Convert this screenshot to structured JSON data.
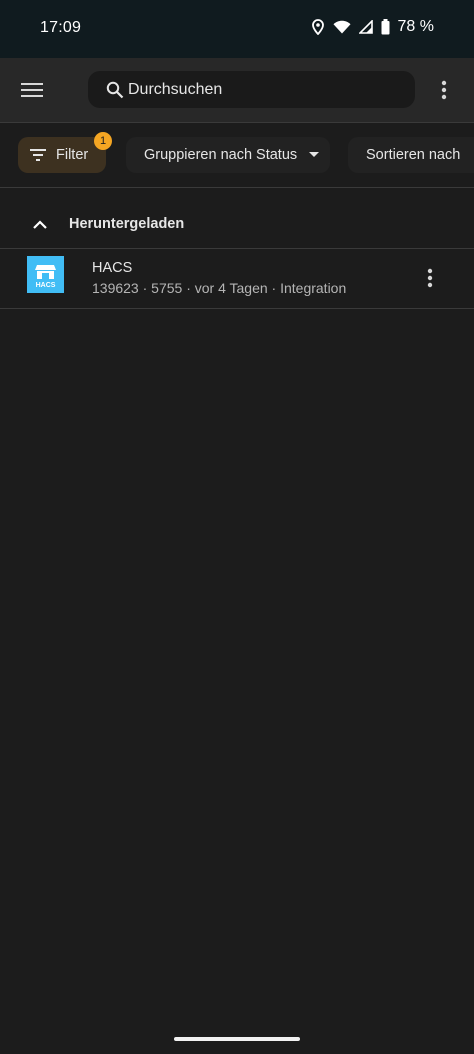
{
  "status_bar": {
    "time": "17:09",
    "battery_text": "78 %",
    "icons": [
      "location-icon",
      "wifi-icon",
      "cell-signal-icon",
      "battery-icon"
    ]
  },
  "app_bar": {
    "menu_icon": "hamburger-menu-icon",
    "search": {
      "placeholder": "Durchsuchen",
      "value": ""
    },
    "overflow_icon": "more-vert-icon"
  },
  "filter_bar": {
    "filter_label": "Filter",
    "filter_badge": "1",
    "group_label": "Gruppieren nach Status",
    "sort_label": "Sortieren nach",
    "accent": "#f5a623"
  },
  "groups": [
    {
      "label": "Heruntergeladen",
      "expanded": true,
      "items": [
        {
          "title": "HACS",
          "subtitle": "139623 · 5755 · vor 4 Tagen · Integration",
          "logo_text": "HACS",
          "logo_color": "#41bdf5"
        }
      ]
    }
  ]
}
